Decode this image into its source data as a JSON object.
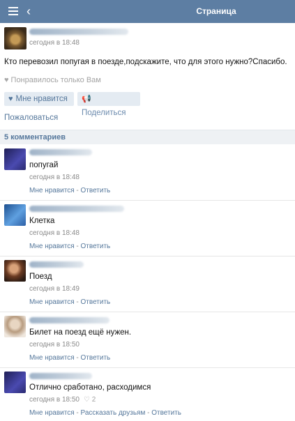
{
  "header": {
    "title": "Страница"
  },
  "post": {
    "time": "сегодня в 18:48",
    "text": "Кто перевозил попугая в поезде,подскажите, что для этого нужно?Спасибо.",
    "liked_only_you": "Понравилось только Вам",
    "like_label": "Мне нравится",
    "share_label": "Поделиться",
    "report_label": "Пожаловаться"
  },
  "comments_header": "5 комментариев",
  "comments": [
    {
      "text": "попугай",
      "time": "сегодня в 18:48",
      "like": "Мне нравится",
      "sep": " - ",
      "reply": "Ответить",
      "avatar_color": "#3a3a8a"
    },
    {
      "text": "Клетка",
      "time": "сегодня в 18:48",
      "like": "Мне нравится",
      "sep": " - ",
      "reply": "Ответить",
      "avatar_color": "#2f6fb5"
    },
    {
      "text": "Поезд",
      "time": "сегодня в 18:49",
      "like": "Мне нравится",
      "sep": " - ",
      "reply": "Ответить",
      "avatar_color": "#6b3b22"
    },
    {
      "text": "Билет на поезд ещё нужен.",
      "time": "сегодня в 18:50",
      "like": "Мне нравится",
      "sep": " - ",
      "reply": "Ответить",
      "avatar_color": "#c9b7a2"
    },
    {
      "text": "Отлично сработано, расходимся",
      "time": "сегодня в 18:50",
      "likes_count": "2",
      "like": "Мне нравится",
      "sep": " - ",
      "tell_friends": "Рассказать друзьям",
      "sep2": " - ",
      "reply": "Ответить",
      "avatar_color": "#3a3a8a"
    }
  ]
}
